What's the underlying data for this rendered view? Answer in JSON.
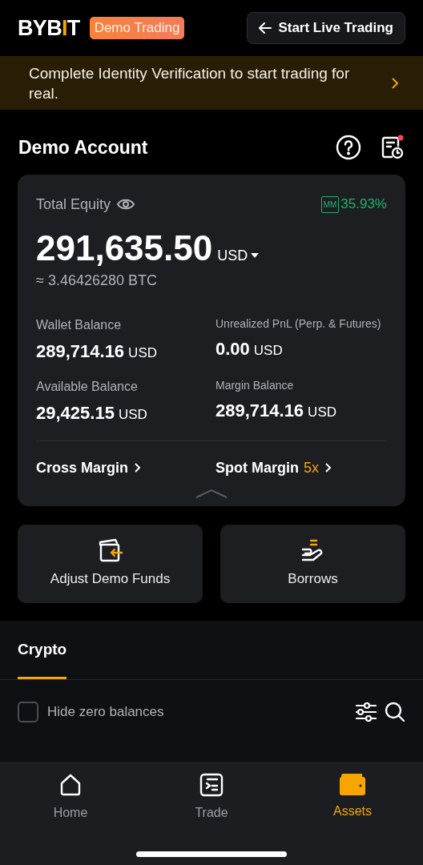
{
  "header": {
    "logo": [
      {
        "text": "BYB",
        "accent": false
      },
      {
        "text": "I",
        "accent": true
      },
      {
        "text": "T",
        "accent": false
      }
    ],
    "badge": "Demo Trading",
    "live_button": "Start Live Trading"
  },
  "banner": {
    "text": "Complete Identity Verification to start trading for real."
  },
  "account": {
    "title": "Demo Account",
    "notification": true
  },
  "card": {
    "equity_label": "Total Equity",
    "mm_label": "MM",
    "mm_value": "35.93%",
    "equity": "291,635.50",
    "currency": "USD",
    "btc": "≈ 3.46426280 BTC",
    "stats": [
      {
        "label": "Wallet Balance",
        "value": "289,714.16",
        "unit": "USD"
      },
      {
        "label": "Unrealized PnL (Perp. & Futures)",
        "value": "0.00",
        "unit": "USD"
      },
      {
        "label": "Available Balance",
        "value": "29,425.15",
        "unit": "USD"
      },
      {
        "label": "Margin Balance",
        "value": "289,714.16",
        "unit": "USD"
      }
    ],
    "links": [
      {
        "label": "Cross Margin"
      },
      {
        "label": "Spot Margin",
        "tag": "5x"
      }
    ]
  },
  "actions": [
    {
      "kind": "funds",
      "label": "Adjust Demo Funds"
    },
    {
      "kind": "borrow",
      "label": "Borrows"
    }
  ],
  "tabs": [
    {
      "label": "Crypto",
      "selected": true
    }
  ],
  "filter": {
    "label": "Hide zero balances",
    "checked": false
  },
  "nav": [
    {
      "kind": "home",
      "label": "Home",
      "selected": false
    },
    {
      "kind": "trade",
      "label": "Trade",
      "selected": false
    },
    {
      "kind": "assets",
      "label": "Assets",
      "selected": true
    }
  ]
}
